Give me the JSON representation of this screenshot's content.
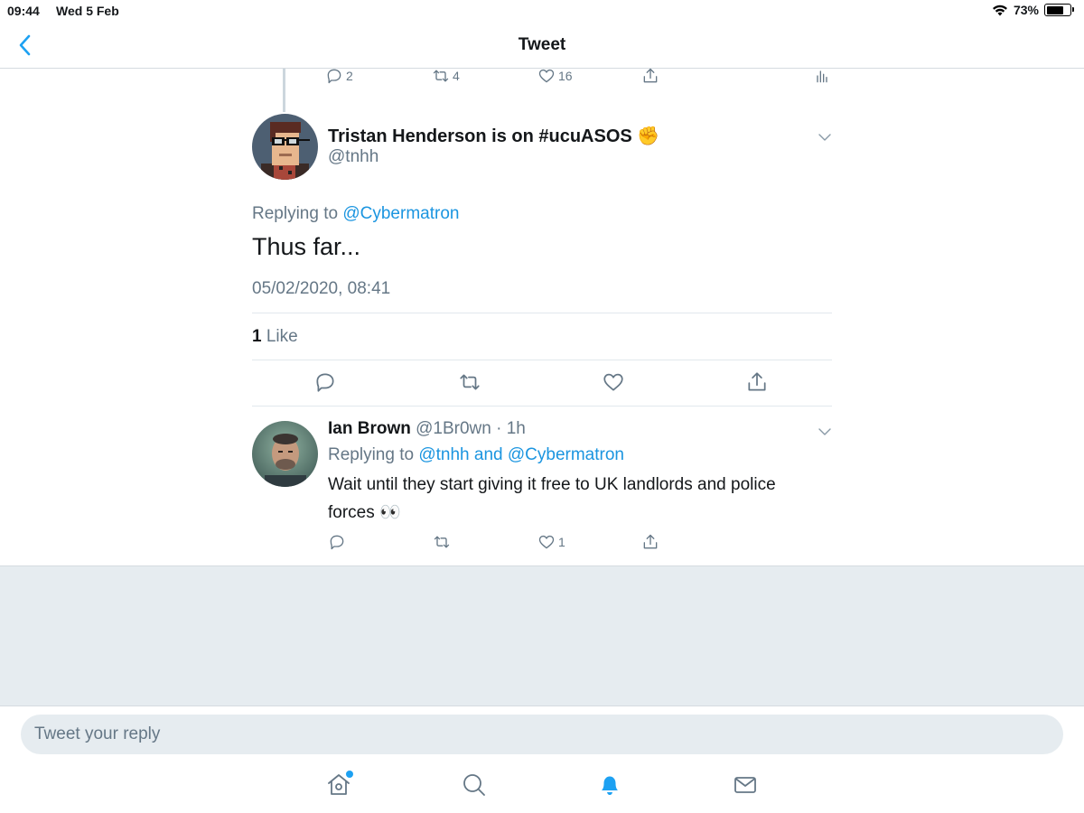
{
  "status_bar": {
    "time": "09:44",
    "date": "Wed 5 Feb",
    "battery": "73%",
    "battery_level": 0.73
  },
  "nav": {
    "title": "Tweet",
    "back_icon": "chevron-left-icon"
  },
  "previous_tweet": {
    "replies": "2",
    "retweets": "4",
    "likes": "16"
  },
  "main_tweet": {
    "author_name": "Tristan Henderson is on #ucuASOS ✊",
    "handle": "@tnhh",
    "replying_prefix": "Replying to ",
    "replying_to": "@Cybermatron",
    "text": "Thus far...",
    "timestamp": "05/02/2020, 08:41",
    "like_count": "1",
    "like_label": " Like"
  },
  "reply_tweet": {
    "author_name": "Ian Brown",
    "handle_time": " @1Br0wn · 1h",
    "replying_prefix": "Replying to ",
    "replying_to": "@tnhh and @Cybermatron",
    "text": "Wait until they start giving it free to UK landlords and police forces 👀",
    "replies": "",
    "retweets": "",
    "likes": "1"
  },
  "composer": {
    "placeholder": "Tweet your reply"
  },
  "tabs": [
    "home-icon",
    "search-icon",
    "notifications-icon",
    "messages-icon"
  ],
  "colors": {
    "accent": "#1da1f2",
    "link": "#1b95e0",
    "secondary_text": "#657786",
    "background_gray": "#e6ecf0"
  }
}
